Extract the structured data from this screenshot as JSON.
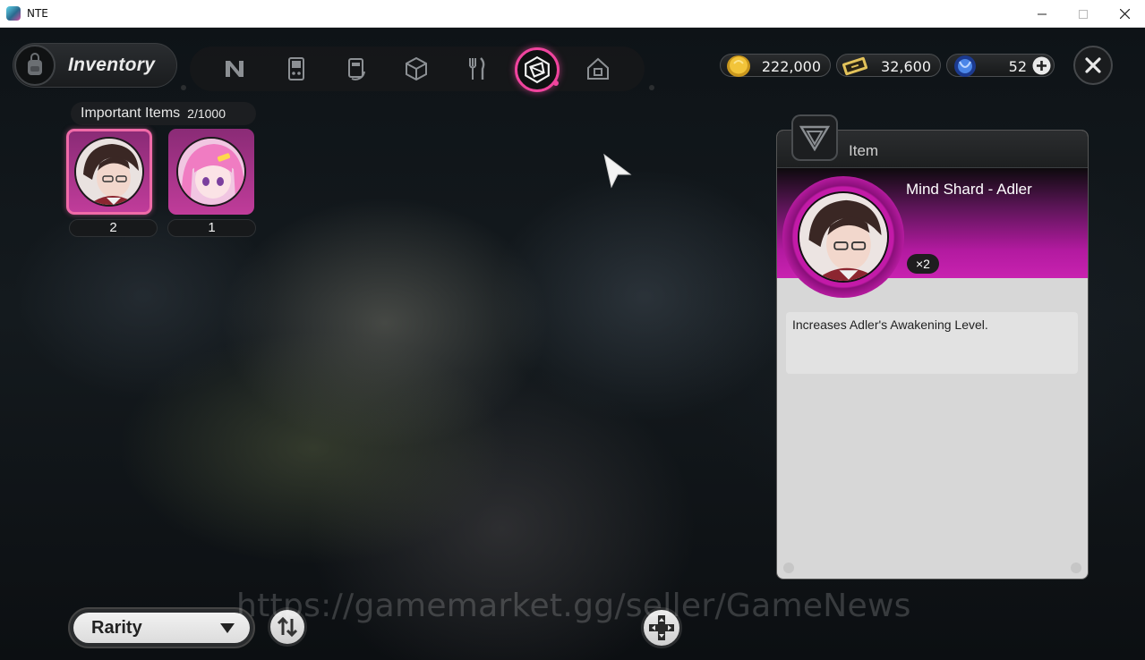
{
  "window": {
    "title": "NTE"
  },
  "header": {
    "section_label": "Inventory",
    "tabs": [
      {
        "name": "tab-n",
        "icon": "n-logo-icon"
      },
      {
        "name": "tab-device",
        "icon": "handheld-console-icon"
      },
      {
        "name": "tab-cards",
        "icon": "card-stack-icon"
      },
      {
        "name": "tab-materials",
        "icon": "cube-icon"
      },
      {
        "name": "tab-food",
        "icon": "fork-knife-icon"
      },
      {
        "name": "tab-important",
        "icon": "shard-icon",
        "active": true
      },
      {
        "name": "tab-home",
        "icon": "house-icon"
      }
    ]
  },
  "currency": {
    "gold": {
      "value": "222,000",
      "icon": "gold-coin-icon"
    },
    "tickets": {
      "value": "32,600",
      "icon": "ticket-icon"
    },
    "crystals": {
      "value": "52",
      "icon": "blue-crystal-icon"
    }
  },
  "section": {
    "title": "Important Items",
    "count": "2/1000"
  },
  "items": [
    {
      "quantity": "2",
      "selected": true,
      "portrait": "dark-haired-man-glasses"
    },
    {
      "quantity": "1",
      "selected": false,
      "portrait": "pink-haired-girl"
    }
  ],
  "detail": {
    "header_label": "Item",
    "name": "Mind Shard - Adler",
    "quantity": "×2",
    "description": "Increases Adler's Awakening Level."
  },
  "bottom": {
    "sort_label": "Rarity"
  },
  "watermark": "https://gamemarket.gg/seller/GameNews",
  "colors": {
    "accent": "#f0449e",
    "item_bg": "#c03c9a",
    "panel_bg": "#d7d7d7"
  }
}
